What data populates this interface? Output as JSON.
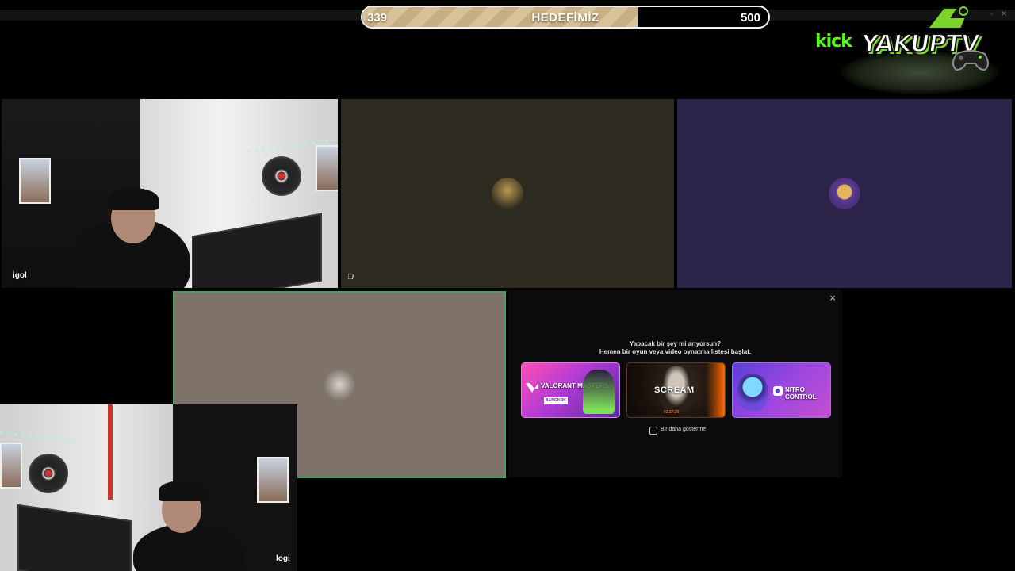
{
  "goal": {
    "current": "339",
    "label": "HEDEFİMİZ",
    "target": "500",
    "progress_fraction": 0.678
  },
  "brand": {
    "platform": "kick",
    "channel": "YAKUPTV",
    "platform_color": "#53fc18"
  },
  "participants": [
    {
      "name_tag": "igol"
    },
    {
      "mute_icon": "🎙̸"
    },
    {},
    {},
    {
      "name_tag": "logi"
    }
  ],
  "activity_panel": {
    "title": "Yapacak bir şey mi arıyorsun?",
    "subtitle": "Hemen bir oyun veya video oynatma listesi başlat.",
    "close_icon": "×",
    "cards": [
      {
        "title": "VALORANT MASTERS",
        "sub": "BANGKOK"
      },
      {
        "title": "SCREAM",
        "sub": "02.27.26"
      },
      {
        "title": "NITRO CONTROL",
        "sub": ""
      }
    ],
    "checkbox_label": "Bir daha gösterme",
    "checkbox_checked": false
  },
  "window_controls": "▫ ✕"
}
